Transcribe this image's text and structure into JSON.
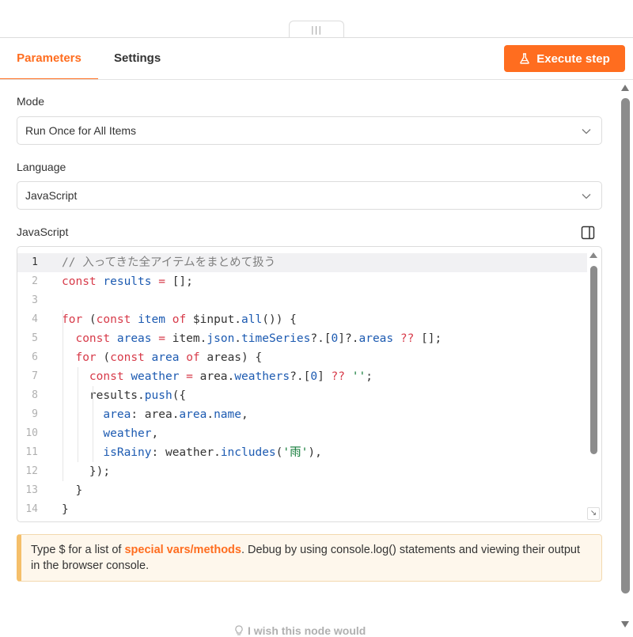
{
  "drag_handle": {
    "glyph": "|||"
  },
  "tabs": [
    {
      "label": "Parameters",
      "active": true
    },
    {
      "label": "Settings",
      "active": false
    }
  ],
  "execute_button": {
    "label": "Execute step",
    "icon": "flask-icon",
    "color": "#ff6d1f"
  },
  "mode": {
    "label": "Mode",
    "value": "Run Once for All Items"
  },
  "language": {
    "label": "Language",
    "value": "JavaScript"
  },
  "editor": {
    "label": "JavaScript",
    "line_numbers": [
      "1",
      "2",
      "3",
      "4",
      "5",
      "6",
      "7",
      "8",
      "9",
      "10",
      "11",
      "12",
      "13",
      "14"
    ],
    "active_line": 1,
    "lines": [
      [
        {
          "t": "// 入ってきた全アイテムをまとめて扱う",
          "c": "cm"
        }
      ],
      [
        {
          "t": "const",
          "c": "kw"
        },
        {
          "t": " "
        },
        {
          "t": "results",
          "c": "vr"
        },
        {
          "t": " "
        },
        {
          "t": "=",
          "c": "kw"
        },
        {
          "t": " [];"
        }
      ],
      [],
      [
        {
          "t": "for",
          "c": "kw"
        },
        {
          "t": " ("
        },
        {
          "t": "const",
          "c": "kw"
        },
        {
          "t": " "
        },
        {
          "t": "item",
          "c": "vr"
        },
        {
          "t": " "
        },
        {
          "t": "of",
          "c": "kw"
        },
        {
          "t": " $input."
        },
        {
          "t": "all",
          "c": "vr"
        },
        {
          "t": "()) {"
        }
      ],
      [
        {
          "t": "  "
        },
        {
          "t": "const",
          "c": "kw"
        },
        {
          "t": " "
        },
        {
          "t": "areas",
          "c": "vr"
        },
        {
          "t": " "
        },
        {
          "t": "=",
          "c": "kw"
        },
        {
          "t": " item."
        },
        {
          "t": "json",
          "c": "vr"
        },
        {
          "t": "."
        },
        {
          "t": "timeSeries",
          "c": "vr"
        },
        {
          "t": "?.["
        },
        {
          "t": "0",
          "c": "vr"
        },
        {
          "t": "]?."
        },
        {
          "t": "areas",
          "c": "vr"
        },
        {
          "t": " "
        },
        {
          "t": "??",
          "c": "kw"
        },
        {
          "t": " [];"
        }
      ],
      [
        {
          "t": "  "
        },
        {
          "t": "for",
          "c": "kw"
        },
        {
          "t": " ("
        },
        {
          "t": "const",
          "c": "kw"
        },
        {
          "t": " "
        },
        {
          "t": "area",
          "c": "vr"
        },
        {
          "t": " "
        },
        {
          "t": "of",
          "c": "kw"
        },
        {
          "t": " areas) {"
        }
      ],
      [
        {
          "t": "    "
        },
        {
          "t": "const",
          "c": "kw"
        },
        {
          "t": " "
        },
        {
          "t": "weather",
          "c": "vr"
        },
        {
          "t": " "
        },
        {
          "t": "=",
          "c": "kw"
        },
        {
          "t": " area."
        },
        {
          "t": "weathers",
          "c": "vr"
        },
        {
          "t": "?.["
        },
        {
          "t": "0",
          "c": "vr"
        },
        {
          "t": "] "
        },
        {
          "t": "??",
          "c": "kw"
        },
        {
          "t": " "
        },
        {
          "t": "''",
          "c": "st"
        },
        {
          "t": ";"
        }
      ],
      [
        {
          "t": "    results."
        },
        {
          "t": "push",
          "c": "vr"
        },
        {
          "t": "({"
        }
      ],
      [
        {
          "t": "      "
        },
        {
          "t": "area",
          "c": "vr"
        },
        {
          "t": ": area."
        },
        {
          "t": "area",
          "c": "vr"
        },
        {
          "t": "."
        },
        {
          "t": "name",
          "c": "vr"
        },
        {
          "t": ","
        }
      ],
      [
        {
          "t": "      "
        },
        {
          "t": "weather",
          "c": "vr"
        },
        {
          "t": ","
        }
      ],
      [
        {
          "t": "      "
        },
        {
          "t": "isRainy",
          "c": "vr"
        },
        {
          "t": ": weather."
        },
        {
          "t": "includes",
          "c": "vr"
        },
        {
          "t": "("
        },
        {
          "t": "'雨'",
          "c": "st"
        },
        {
          "t": "),"
        }
      ],
      [
        {
          "t": "    });"
        }
      ],
      [
        {
          "t": "  }"
        }
      ],
      [
        {
          "t": "}"
        }
      ]
    ]
  },
  "notice": {
    "prefix": "Type $ for a list of ",
    "link": "special vars/methods",
    "suffix": ". Debug by using console.log() statements and viewing their output in the browser console."
  },
  "feedback": {
    "label": "I wish this node would",
    "icon": "lightbulb-icon"
  },
  "colors": {
    "accent": "#ff6d1f",
    "notice_border": "#f5bf6a",
    "notice_bg": "#fef7ec"
  }
}
